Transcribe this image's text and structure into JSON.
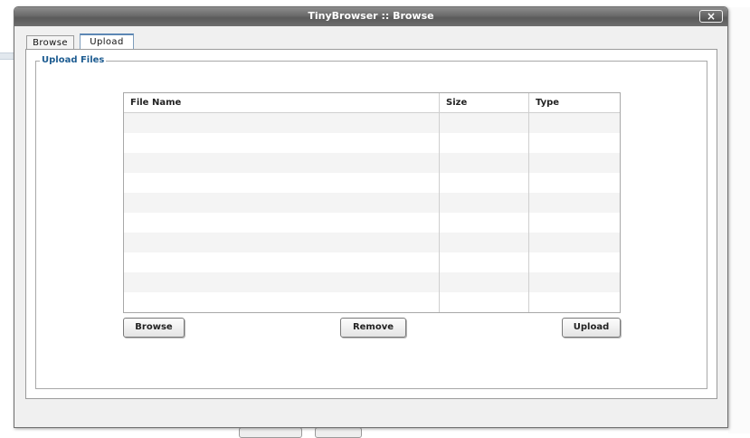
{
  "dialog": {
    "title": "TinyBrowser :: Browse",
    "close_icon": "×"
  },
  "tabs": [
    {
      "label": "Browse",
      "active": false
    },
    {
      "label": "Upload",
      "active": true
    }
  ],
  "upload": {
    "legend": "Upload Files",
    "columns": [
      "File Name",
      "Size",
      "Type"
    ],
    "rows": [
      [
        "",
        "",
        ""
      ],
      [
        "",
        "",
        ""
      ],
      [
        "",
        "",
        ""
      ],
      [
        "",
        "",
        ""
      ],
      [
        "",
        "",
        ""
      ],
      [
        "",
        "",
        ""
      ],
      [
        "",
        "",
        ""
      ],
      [
        "",
        "",
        ""
      ],
      [
        "",
        "",
        ""
      ],
      [
        "",
        "",
        ""
      ]
    ],
    "buttons": {
      "browse": "Browse",
      "remove": "Remove",
      "upload": "Upload"
    }
  },
  "colors": {
    "legend": "#1d5c91",
    "titlebar": "#6a6a6a",
    "row_alt": "#f4f4f4"
  }
}
